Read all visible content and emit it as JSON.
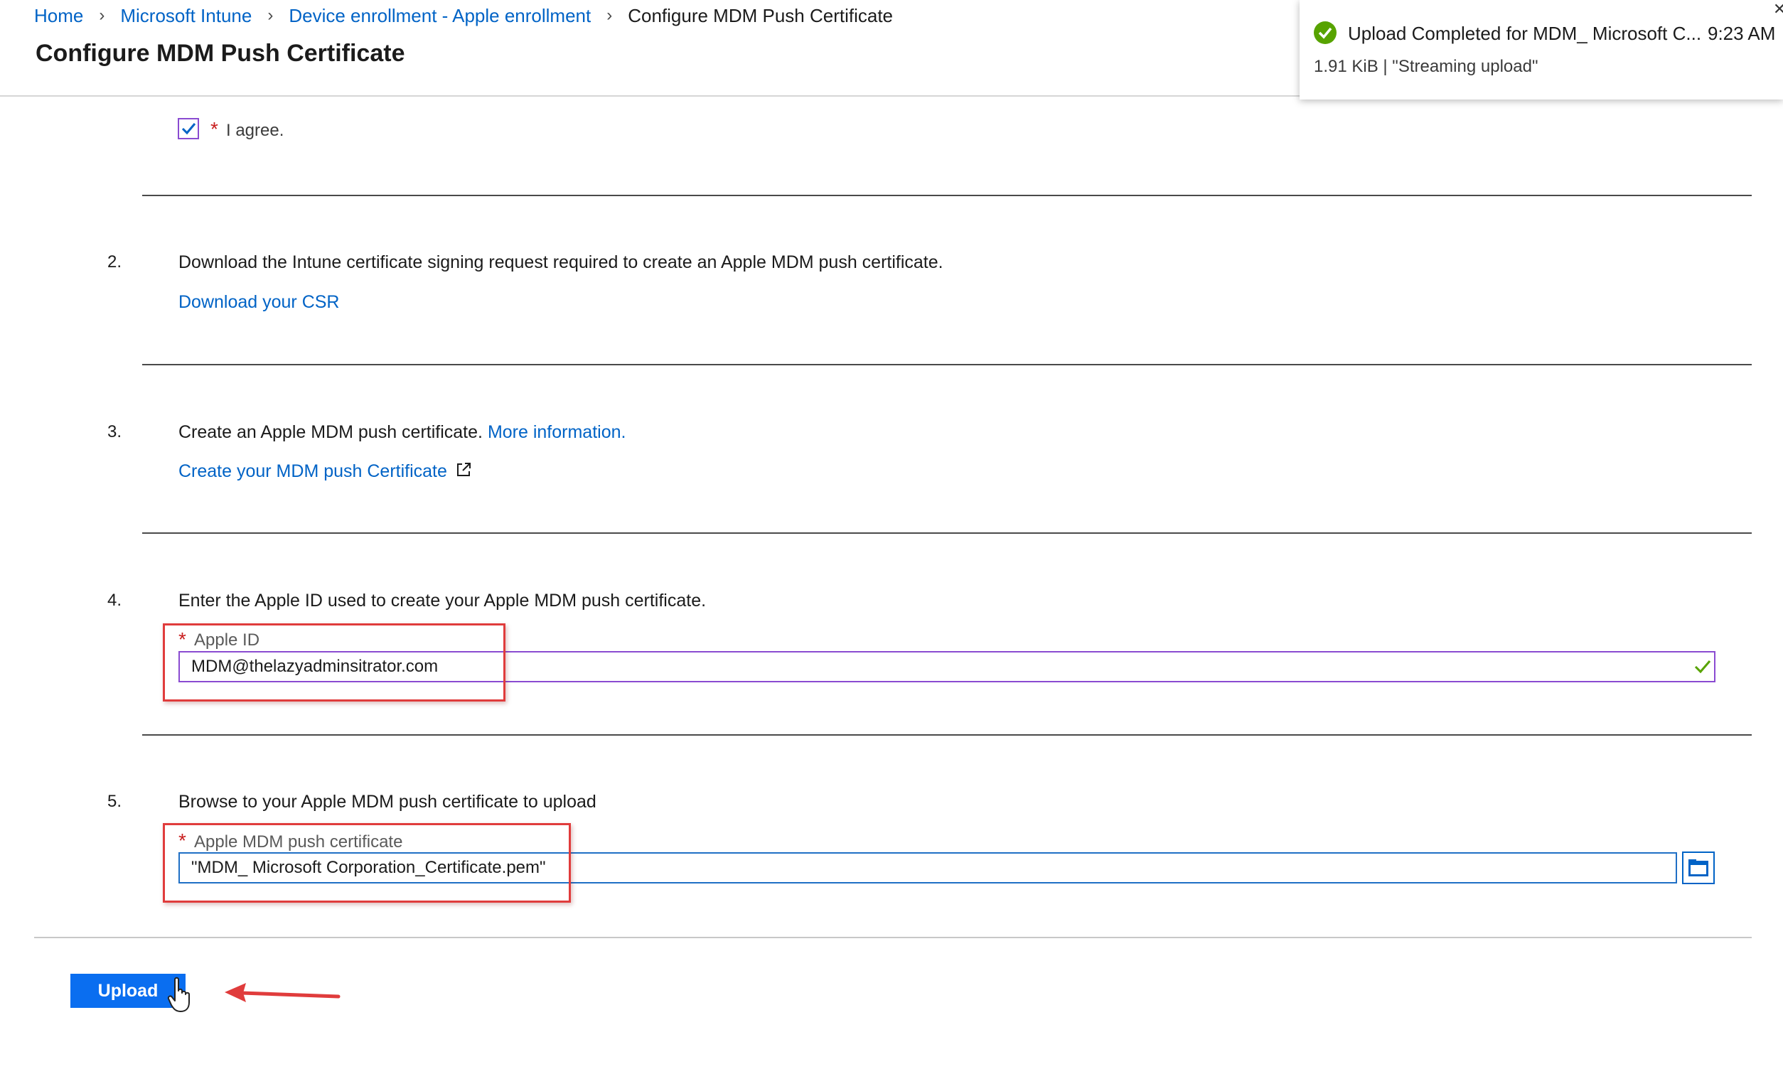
{
  "breadcrumb": {
    "items": [
      "Home",
      "Microsoft Intune",
      "Device enrollment - Apple enrollment"
    ],
    "current": "Configure MDM Push Certificate"
  },
  "page": {
    "title": "Configure MDM Push Certificate"
  },
  "toast": {
    "title": "Upload Completed for MDM_ Microsoft C...",
    "time": "9:23 AM",
    "subtitle": "1.91 KiB | \"Streaming upload\""
  },
  "step1": {
    "agree_label": "I agree.",
    "checked": true
  },
  "step2": {
    "number": "2.",
    "text": "Download the Intune certificate signing request required to create an Apple MDM push certificate.",
    "link": "Download your CSR"
  },
  "step3": {
    "number": "3.",
    "text": "Create an Apple MDM push certificate.",
    "more_info": "More information.",
    "link": "Create your MDM push Certificate"
  },
  "step4": {
    "number": "4.",
    "text": "Enter the Apple ID used to create your Apple MDM push certificate.",
    "field_label": "Apple ID",
    "field_value": "MDM@thelazyadminsitrator.com"
  },
  "step5": {
    "number": "5.",
    "text": "Browse to your Apple MDM push certificate to upload",
    "field_label": "Apple MDM push certificate",
    "field_value": "\"MDM_ Microsoft Corporation_Certificate.pem\""
  },
  "actions": {
    "upload_label": "Upload"
  },
  "colors": {
    "link": "#0063c6",
    "primary": "#0a6ef0",
    "success": "#57a300",
    "required": "#c81e1e",
    "highlight": "#e03c3c"
  }
}
